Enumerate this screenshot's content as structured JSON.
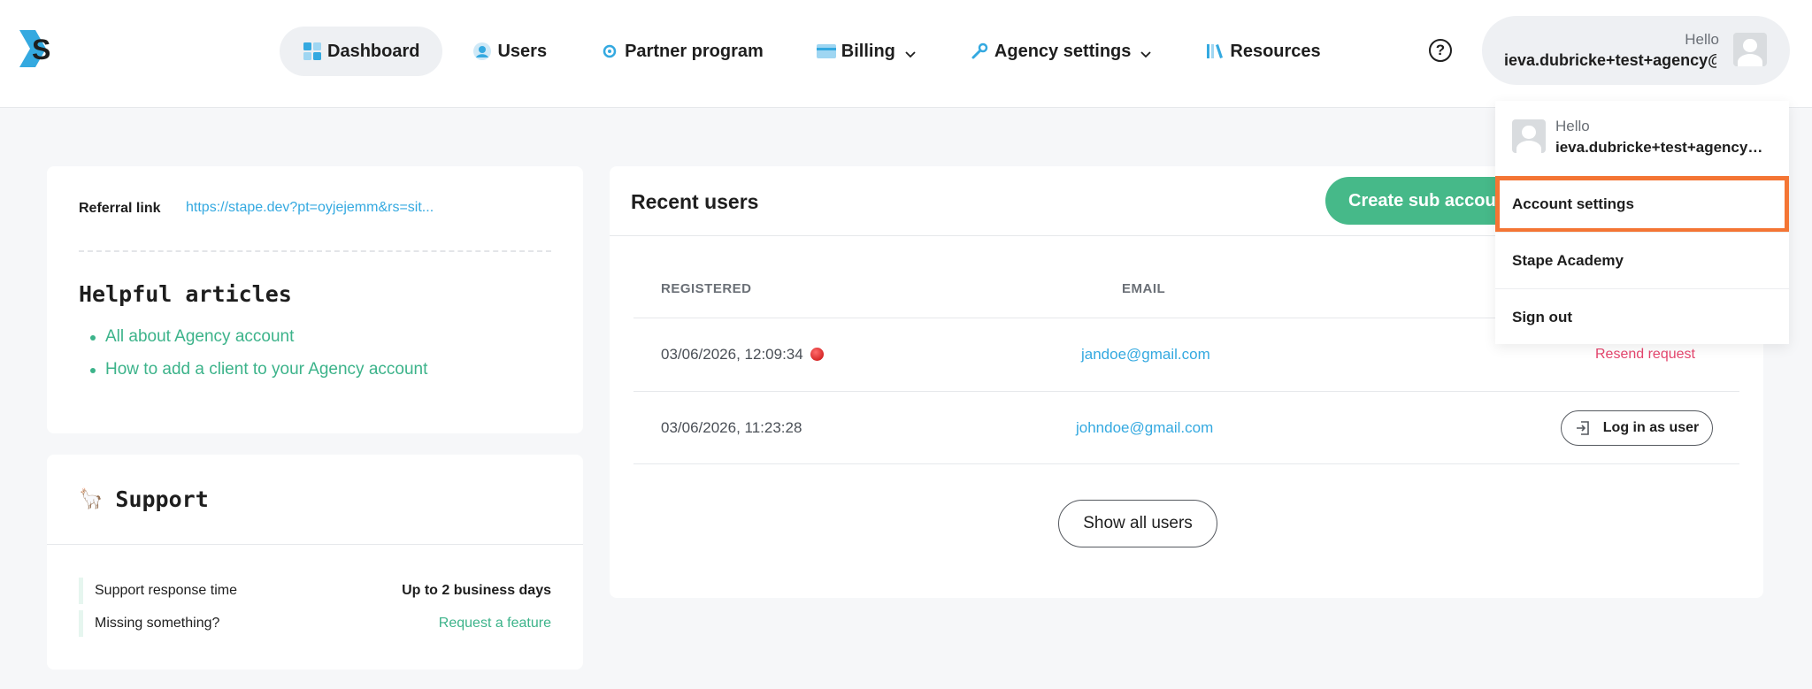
{
  "header": {
    "logo": "stape-logo",
    "nav": [
      {
        "label": "Dashboard",
        "icon": "dashboard-icon",
        "active": true
      },
      {
        "label": "Users",
        "icon": "user-icon"
      },
      {
        "label": "Partner program",
        "icon": "partner-icon"
      },
      {
        "label": "Billing",
        "icon": "card-icon",
        "dropdown": true
      },
      {
        "label": "Agency settings",
        "icon": "wrench-icon",
        "dropdown": true
      },
      {
        "label": "Resources",
        "icon": "books-icon"
      }
    ],
    "help_glyph": "?",
    "user": {
      "greeting": "Hello",
      "email": "ieva.dubricke+test+agency@..."
    }
  },
  "referral": {
    "label": "Referral link",
    "link": "https://stape.dev?pt=oyjejemm&rs=sit..."
  },
  "helpful_articles": {
    "title": "Helpful articles",
    "items": [
      "All about Agency account",
      "How to add a client to your Agency account"
    ]
  },
  "support": {
    "emoji": "🦙",
    "title": "Support",
    "rows": [
      {
        "label": "Support response time",
        "value": "Up to 2 business days"
      },
      {
        "label": "Missing something?",
        "value": "Request a feature"
      }
    ]
  },
  "recent_users": {
    "title": "Recent users",
    "create_button": "Create sub account",
    "columns": [
      "REGISTERED",
      "EMAIL"
    ],
    "rows": [
      {
        "registered": "03/06/2026, 12:09:34",
        "email": "jandoe@gmail.com",
        "action": "Resend request",
        "pending": true
      },
      {
        "registered": "03/06/2026, 11:23:28",
        "email": "johndoe@gmail.com",
        "action": "Log in as user",
        "pending": false
      }
    ],
    "show_all_button": "Show all users"
  },
  "dropdown": {
    "greeting": "Hello",
    "email": "ieva.dubricke+test+agency@gmail.com",
    "items": [
      "Account settings",
      "Stape Academy",
      "Sign out"
    ],
    "highlighted_index": 0
  },
  "colors": {
    "accent_green": "#46b989",
    "link_blue": "#34a9e0",
    "resend_red": "#e5466e",
    "highlight_orange": "#f47534"
  }
}
